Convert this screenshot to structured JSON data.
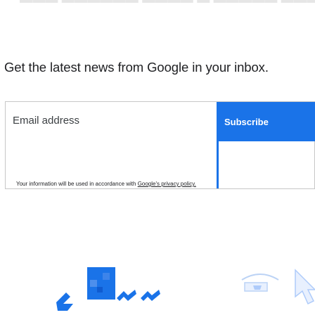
{
  "signup": {
    "headline": "Get the latest news from Google in your inbox.",
    "email_placeholder": "Email address",
    "subscribe_label": "Subscribe",
    "disclaimer_prefix": "Your information will be used in accordance with ",
    "policy_link": "Google's privacy policy.",
    "colors": {
      "button": "#1a73e8",
      "border": "#c7c7c7"
    }
  },
  "icons": {
    "left_group": [
      "blue-shape-icon",
      "blue-square-icon",
      "blue-squiggle-icon",
      "blue-squiggle-icon"
    ],
    "right_group": [
      "chat-bubble-icon",
      "cursor-arrow-icon"
    ]
  }
}
